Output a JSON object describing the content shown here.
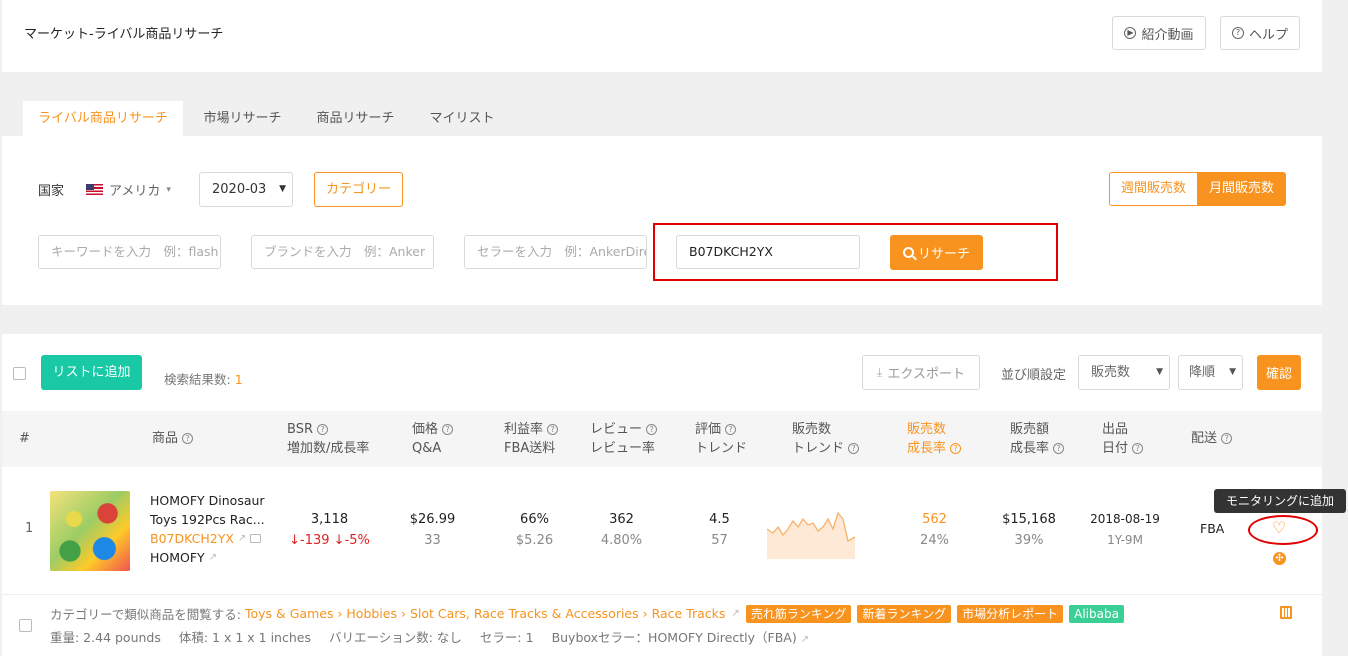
{
  "header": {
    "title": "マーケット-ライバル商品リサーチ",
    "intro_video": "紹介動画",
    "help": "ヘルプ"
  },
  "tabs": [
    "ライバル商品リサーチ",
    "市場リサーチ",
    "商品リサーチ",
    "マイリスト"
  ],
  "filters": {
    "country_label": "国家",
    "country_value": "アメリカ",
    "month_value": "2020-03",
    "category_button": "カテゴリー",
    "weekly_sales": "週間販売数",
    "monthly_sales": "月間販売数",
    "keyword_placeholder": "キーワードを入力　例：flash",
    "brand_placeholder": "ブランドを入力　例：Anker",
    "seller_placeholder": "セラーを入力　例：AnkerDirect",
    "asin_value": "B07DKCH2YX",
    "search_button": "リサーチ"
  },
  "toolbar": {
    "add_to_list": "リストに追加",
    "result_label": "検索結果数:",
    "result_count": "1",
    "export": "エクスポート",
    "sort_label": "並び順設定",
    "sort_field": "販売数",
    "sort_order": "降順",
    "confirm": "確認"
  },
  "columns": {
    "index": "#",
    "product": "商品",
    "bsr_1": "BSR",
    "bsr_2": "増加数/成長率",
    "price_1": "価格",
    "price_2": "Q&A",
    "margin_1": "利益率",
    "margin_2": "FBA送料",
    "review_1": "レビュー",
    "review_2": "レビュー率",
    "rating_1": "評価",
    "rating_2": "トレンド",
    "sales_trend_1": "販売数",
    "sales_trend_2": "トレンド",
    "sales_1": "販売数",
    "sales_2": "成長率",
    "revenue_1": "販売額",
    "revenue_2": "成長率",
    "listed_1": "出品",
    "listed_2": "日付",
    "shipping": "配送"
  },
  "row": {
    "index": "1",
    "title_line1": "HOMOFY Dinosaur",
    "title_line2": "Toys 192Pcs Rac...",
    "asin": "B07DKCH2YX",
    "brand": "HOMOFY",
    "bsr": "3,118",
    "bsr_change": "-139",
    "bsr_rate": "-5%",
    "price": "$26.99",
    "qa": "33",
    "margin": "66%",
    "fba_fee": "$5.26",
    "reviews": "362",
    "review_rate": "4.80%",
    "rating": "4.5",
    "rating_trend": "57",
    "sales": "562",
    "sales_growth": "24%",
    "revenue": "$15,168",
    "revenue_growth": "39%",
    "listed_date": "2018-08-19",
    "listed_age": "1Y-9M",
    "shipping": "FBA",
    "tooltip": "モニタリングに追加"
  },
  "details": {
    "category_prefix": "カテゴリーで類似商品を閲覧する:",
    "category_path": "Toys & Games › Hobbies › Slot Cars, Race Tracks & Accessories › Race Tracks",
    "tag_bestseller": "売れ筋ランキング",
    "tag_new": "新着ランキング",
    "tag_market": "市場分析レポート",
    "tag_alibaba": "Alibaba",
    "weight": "重量: 2.44 pounds",
    "volume": "体積: 1 x 1 x 1 inches",
    "variations": "バリエーション数: なし",
    "sellers": "セラー: 1",
    "buybox": "Buyboxセラー：HOMOFY Directly（FBA)"
  },
  "colors": {
    "accent": "#f7931e",
    "green": "#19c8a5",
    "down": "#e02020",
    "highlight": "#e00000"
  }
}
